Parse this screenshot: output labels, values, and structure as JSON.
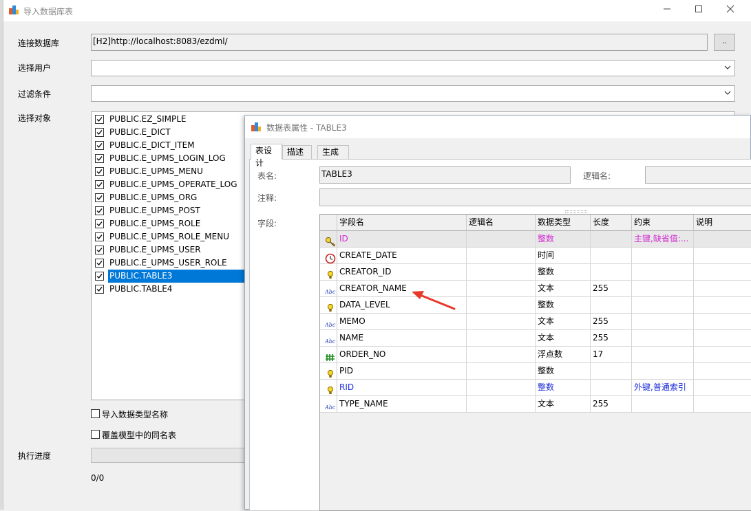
{
  "main_window": {
    "title": "导入数据库表",
    "connect_label": "连接数据库",
    "connect_value": "[H2]http://localhost:8083/ezdml/",
    "browse_label": "..",
    "user_label": "选择用户",
    "user_value": "",
    "filter_label": "过滤条件",
    "filter_value": "",
    "objects_label": "选择对象",
    "objects": [
      {
        "name": "PUBLIC.EZ_SIMPLE",
        "checked": true
      },
      {
        "name": "PUBLIC.E_DICT",
        "checked": true
      },
      {
        "name": "PUBLIC.E_DICT_ITEM",
        "checked": true
      },
      {
        "name": "PUBLIC.E_UPMS_LOGIN_LOG",
        "checked": true
      },
      {
        "name": "PUBLIC.E_UPMS_MENU",
        "checked": true
      },
      {
        "name": "PUBLIC.E_UPMS_OPERATE_LOG",
        "checked": true
      },
      {
        "name": "PUBLIC.E_UPMS_ORG",
        "checked": true
      },
      {
        "name": "PUBLIC.E_UPMS_POST",
        "checked": true
      },
      {
        "name": "PUBLIC.E_UPMS_ROLE",
        "checked": true
      },
      {
        "name": "PUBLIC.E_UPMS_ROLE_MENU",
        "checked": true
      },
      {
        "name": "PUBLIC.E_UPMS_USER",
        "checked": true
      },
      {
        "name": "PUBLIC.E_UPMS_USER_ROLE",
        "checked": true
      },
      {
        "name": "PUBLIC.TABLE3",
        "checked": true,
        "selected": true
      },
      {
        "name": "PUBLIC.TABLE4",
        "checked": true
      }
    ],
    "import_type_names_label": "导入数据类型名称",
    "overwrite_same_name_label": "覆盖模型中的同名表",
    "progress_label": "执行进度",
    "progress_fraction": 0,
    "progress_text": "0/0"
  },
  "props_window": {
    "title": "数据表属性 - TABLE3",
    "tabs": [
      "表设计",
      "描述",
      "生成"
    ],
    "active_tab": 0,
    "table_name_label": "表名:",
    "table_name_value": "TABLE3",
    "logical_name_label": "逻辑名:",
    "logical_name_value": "",
    "comment_label": "注释:",
    "comment_value": "",
    "fields_label": "字段:",
    "columns": [
      "字段名",
      "逻辑名",
      "数据类型",
      "长度",
      "约束",
      "说明"
    ],
    "rows": [
      {
        "icon": "key-icon",
        "name": "ID",
        "logical": "",
        "type": "整数",
        "length": "",
        "constraint": "主键,缺省值:...",
        "desc": "",
        "color": "#d22ad2",
        "selected": true
      },
      {
        "icon": "clock-icon",
        "name": "CREATE_DATE",
        "logical": "",
        "type": "时间",
        "length": "",
        "constraint": "",
        "desc": "",
        "color": "#000000"
      },
      {
        "icon": "bulb-icon",
        "name": "CREATOR_ID",
        "logical": "",
        "type": "整数",
        "length": "",
        "constraint": "",
        "desc": "",
        "color": "#000000"
      },
      {
        "icon": "abc-icon",
        "name": "CREATOR_NAME",
        "logical": "",
        "type": "文本",
        "length": "255",
        "constraint": "",
        "desc": "",
        "color": "#000000"
      },
      {
        "icon": "bulb-icon",
        "name": "DATA_LEVEL",
        "logical": "",
        "type": "整数",
        "length": "",
        "constraint": "",
        "desc": "",
        "color": "#000000"
      },
      {
        "icon": "abc-icon",
        "name": "MEMO",
        "logical": "",
        "type": "文本",
        "length": "255",
        "constraint": "",
        "desc": "",
        "color": "#000000"
      },
      {
        "icon": "abc-icon",
        "name": "NAME",
        "logical": "",
        "type": "文本",
        "length": "255",
        "constraint": "",
        "desc": "",
        "color": "#000000"
      },
      {
        "icon": "number-icon",
        "name": "ORDER_NO",
        "logical": "",
        "type": "浮点数",
        "length": "17",
        "constraint": "",
        "desc": "",
        "color": "#000000"
      },
      {
        "icon": "bulb-icon",
        "name": "PID",
        "logical": "",
        "type": "整数",
        "length": "",
        "constraint": "",
        "desc": "",
        "color": "#000000"
      },
      {
        "icon": "bulb-icon",
        "name": "RID",
        "logical": "",
        "type": "整数",
        "length": "",
        "constraint": "外键,普通索引",
        "desc": "",
        "color": "#1c2ed6"
      },
      {
        "icon": "abc-icon",
        "name": "TYPE_NAME",
        "logical": "",
        "type": "文本",
        "length": "255",
        "constraint": "",
        "desc": "",
        "color": "#000000"
      }
    ]
  }
}
